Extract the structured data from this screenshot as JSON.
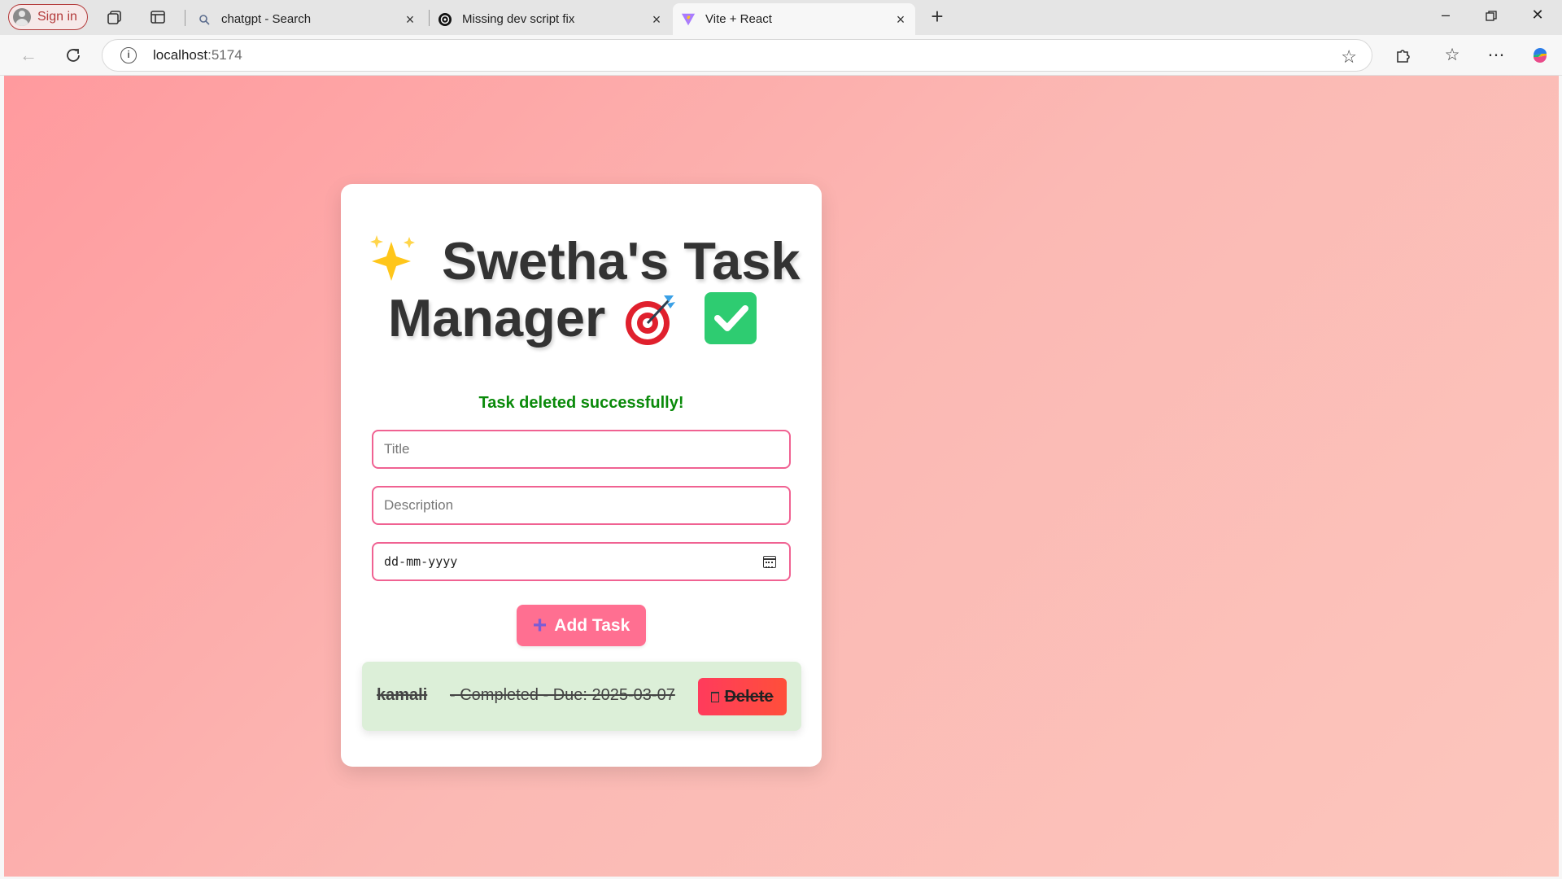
{
  "browser": {
    "signin_label": "Sign in",
    "tabs": [
      {
        "title": "chatgpt - Search",
        "icon": "search-icon"
      },
      {
        "title": "Missing dev script fix",
        "icon": "openai-icon"
      },
      {
        "title": "Vite + React",
        "icon": "vite-icon"
      }
    ],
    "url_host": "localhost",
    "url_port": ":5174"
  },
  "app": {
    "title_line1": "Swetha's Task",
    "title_line2": "Manager",
    "status_message": "Task deleted successfully!",
    "title_placeholder": "Title",
    "description_placeholder": "Description",
    "date_placeholder": "dd-mm-yyyy",
    "add_button_label": "Add Task",
    "add_button_icon": "+",
    "tasks": [
      {
        "title": "kamali",
        "meta": " - Completed - Due: 2025-03-07",
        "delete_label": "Delete"
      }
    ]
  },
  "colors": {
    "accent": "#ff6f91",
    "field_border": "#f06292",
    "success": "#0a8a0a",
    "task_bg": "#dcefd8",
    "delete_bg": "#ff3b5c"
  }
}
